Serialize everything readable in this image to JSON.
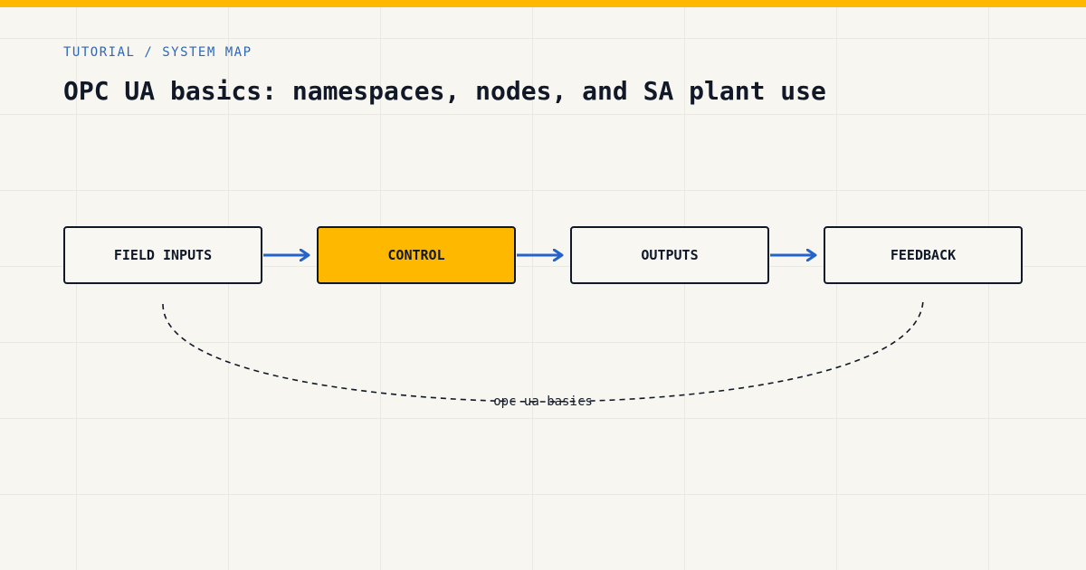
{
  "header": {
    "eyebrow": "TUTORIAL / SYSTEM MAP",
    "title": "OPC UA basics: namespaces, nodes, and SA plant use"
  },
  "flow": {
    "nodes": [
      {
        "label": "FIELD INPUTS",
        "active": false
      },
      {
        "label": "CONTROL",
        "active": true
      },
      {
        "label": "OUTPUTS",
        "active": false
      },
      {
        "label": "FEEDBACK",
        "active": false
      }
    ],
    "loop_label": "opc ua basics"
  },
  "colors": {
    "accent": "#ffb800",
    "arrow": "#2563c9",
    "ink": "#111827",
    "eyebrow": "#2e67b8"
  },
  "icons": [
    "arrow-right-icon"
  ]
}
